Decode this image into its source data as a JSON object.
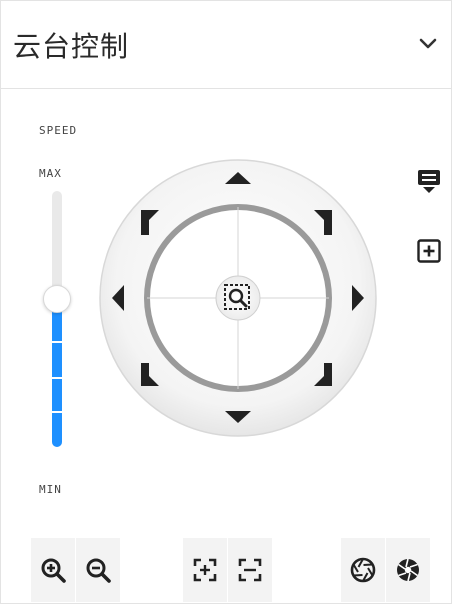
{
  "header": {
    "title": "云台控制",
    "collapse_icon": "chevron-down-icon"
  },
  "speed": {
    "label": "SPEED",
    "max_label": "MAX",
    "min_label": "MIN",
    "level": 0.58
  },
  "ptz": {
    "directions": [
      "up",
      "up-right",
      "right",
      "down-right",
      "down",
      "down-left",
      "left",
      "up-left"
    ],
    "center_icon": "zoom-area-icon"
  },
  "side_tools": [
    "preset-icon",
    "add-preset-icon"
  ],
  "toolbar": {
    "zoom": [
      "zoom-in-icon",
      "zoom-out-icon"
    ],
    "focus": [
      "focus-near-icon",
      "focus-far-icon"
    ],
    "iris": [
      "iris-open-icon",
      "iris-close-icon"
    ]
  },
  "colors": {
    "accent": "#1e90ff",
    "icon": "#222222",
    "ring": "#9a9a9a"
  }
}
